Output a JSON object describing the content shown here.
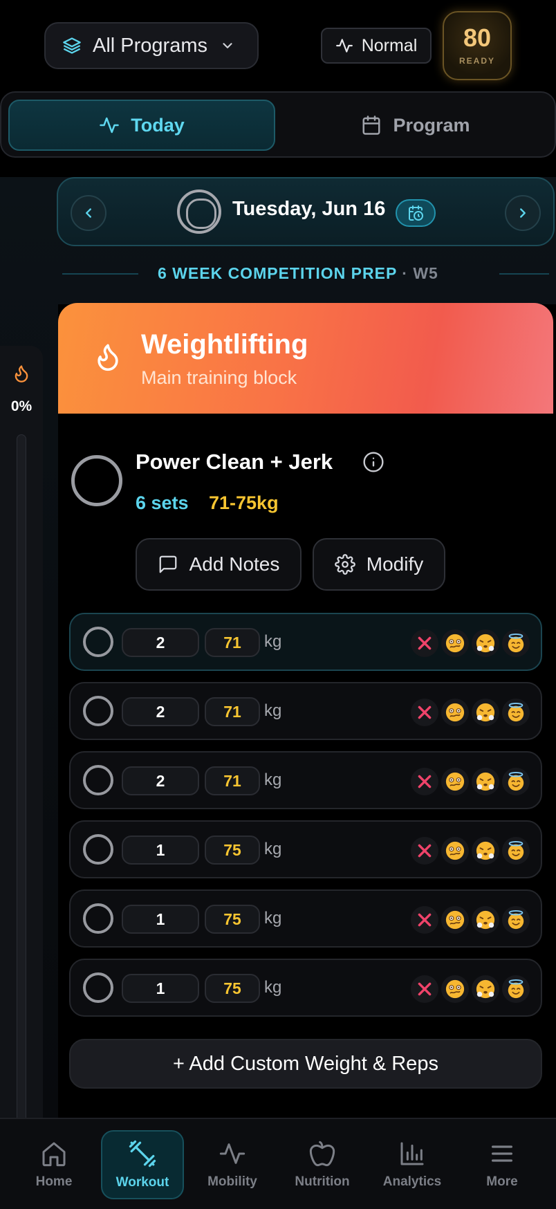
{
  "header": {
    "program_select": "All Programs",
    "status": "Normal",
    "readiness": {
      "score": "80",
      "label": "READY"
    }
  },
  "tabs": [
    {
      "label": "Today",
      "active": true
    },
    {
      "label": "Program",
      "active": false
    }
  ],
  "date_nav": {
    "date": "Tuesday, Jun 16"
  },
  "program": {
    "name": "6 WEEK COMPETITION PREP",
    "week": "· W5"
  },
  "progress": {
    "percent": "0%",
    "fraction": 0
  },
  "block": {
    "title": "Weightlifting",
    "subtitle": "Main training block",
    "gradient": [
      "#fb923c",
      "#f25b4d",
      "#f3777a"
    ]
  },
  "exercise": {
    "name": "Power Clean + Jerk",
    "sets_label": "6 sets",
    "weight_label": "71-75kg",
    "notes_button": "Add Notes",
    "modify_button": "Modify"
  },
  "sets": [
    {
      "reps": "2",
      "weight": "71",
      "unit": "kg"
    },
    {
      "reps": "2",
      "weight": "71",
      "unit": "kg"
    },
    {
      "reps": "2",
      "weight": "71",
      "unit": "kg"
    },
    {
      "reps": "1",
      "weight": "75",
      "unit": "kg"
    },
    {
      "reps": "1",
      "weight": "75",
      "unit": "kg"
    },
    {
      "reps": "1",
      "weight": "75",
      "unit": "kg"
    }
  ],
  "add_custom": "+ Add Custom Weight & Reps",
  "bottom_nav": [
    {
      "label": "Home",
      "icon": "home-icon"
    },
    {
      "label": "Workout",
      "icon": "dumbbell-icon",
      "active": true
    },
    {
      "label": "Mobility",
      "icon": "activity-icon"
    },
    {
      "label": "Nutrition",
      "icon": "apple-icon"
    },
    {
      "label": "Analytics",
      "icon": "bar-chart-icon"
    },
    {
      "label": "More",
      "icon": "menu-icon"
    }
  ],
  "colors": {
    "accent": "#5cd4ec",
    "weight": "#f7c531",
    "fail": "#f0436a"
  }
}
